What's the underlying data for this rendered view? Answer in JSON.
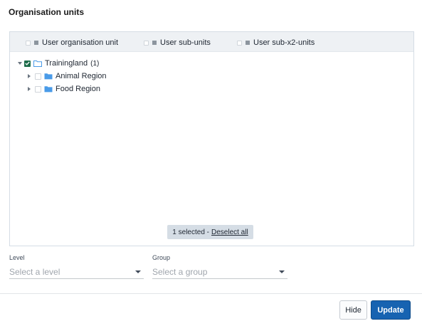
{
  "dialog": {
    "title": "Organisation units"
  },
  "options": [
    {
      "label": "User organisation unit",
      "checked": false
    },
    {
      "label": "User sub-units",
      "checked": false
    },
    {
      "label": "User sub-x2-units",
      "checked": false
    }
  ],
  "tree": {
    "root": {
      "label": "Trainingland",
      "count": "(1)",
      "checked": true,
      "expanded": true
    },
    "children": [
      {
        "label": "Animal Region",
        "checked": false,
        "expanded": false
      },
      {
        "label": "Food Region",
        "checked": false,
        "expanded": false
      }
    ]
  },
  "selection": {
    "summary": "1 selected -",
    "deselect_label": "Deselect all"
  },
  "level": {
    "label": "Level",
    "placeholder": "Select a level"
  },
  "group": {
    "label": "Group",
    "placeholder": "Select a group"
  },
  "footer": {
    "hide_label": "Hide",
    "update_label": "Update"
  },
  "colors": {
    "primary": "#1763b1",
    "checkbox_checked": "#1e6d4b",
    "folder": "#4a9be8"
  }
}
